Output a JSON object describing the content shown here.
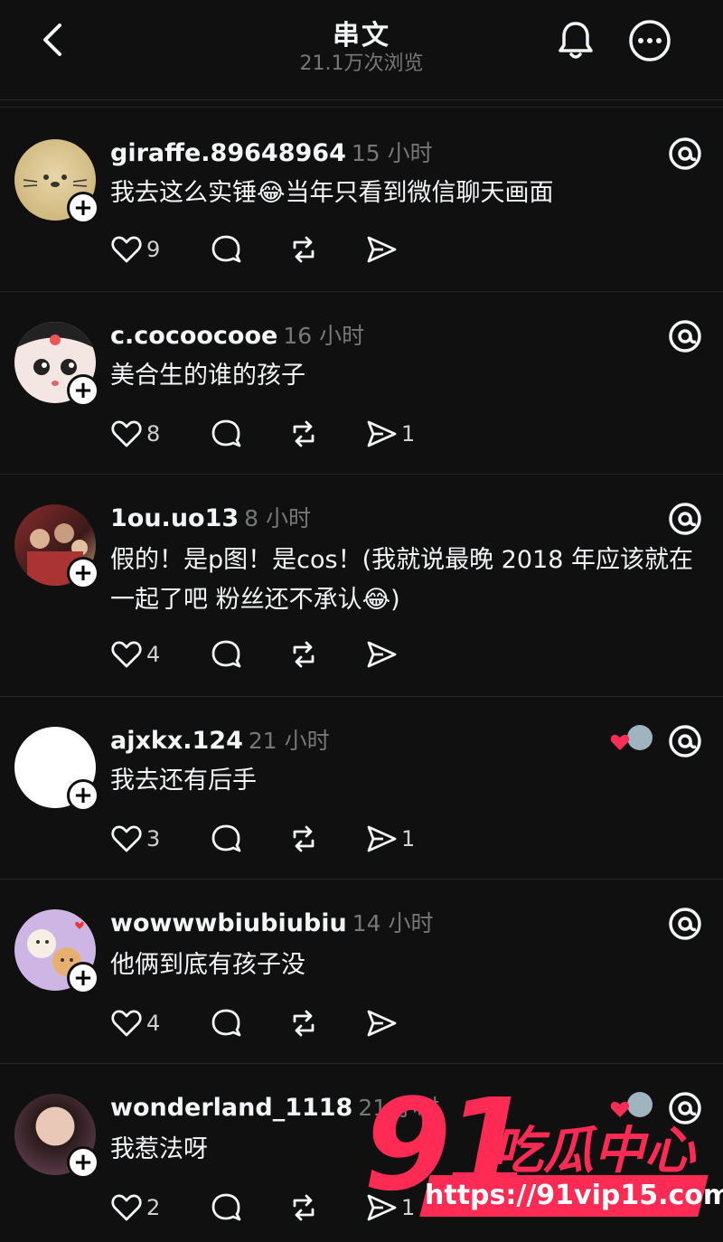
{
  "header": {
    "title": "串文",
    "views": "21.1万次浏览"
  },
  "posts": [
    {
      "username": "giraffe.89648964",
      "time": "15 小时",
      "text": "我去这么实锤😂当年只看到微信聊天画面",
      "likes": "9",
      "shares": ""
    },
    {
      "username": "c.cocoocooe",
      "time": "16 小时",
      "text": "美合生的谁的孩子",
      "likes": "8",
      "shares": "1"
    },
    {
      "username": "1ou.uo13",
      "time": "8 小时",
      "text": "假的！是p图！是cos！(我就说最晚 2018 年应该就在一起了吧 粉丝还不承认😂)",
      "likes": "4",
      "shares": ""
    },
    {
      "username": "ajxkx.124",
      "time": "21 小时",
      "text": "我去还有后手",
      "likes": "3",
      "shares": "1"
    },
    {
      "username": "wowwwbiubiubiu",
      "time": "14 小时",
      "text": "他俩到底有孩子没",
      "likes": "4",
      "shares": ""
    },
    {
      "username": "wonderland_1118",
      "time": "21 小时",
      "text": "我惹法呀",
      "likes": "2",
      "shares": "1"
    }
  ],
  "watermark": {
    "number": "91",
    "name": "吃瓜中心",
    "url": "https://91vip15.com"
  },
  "colors": {
    "background": "#101010",
    "text": "#f3f5f7",
    "muted": "#777777",
    "accent": "#ff2b55",
    "like": "#ff2d55"
  },
  "icons": [
    "back-arrow-icon",
    "bell-icon",
    "more-icon",
    "threads-icon",
    "heart-icon",
    "comment-icon",
    "repost-icon",
    "share-icon",
    "plus-icon"
  ]
}
